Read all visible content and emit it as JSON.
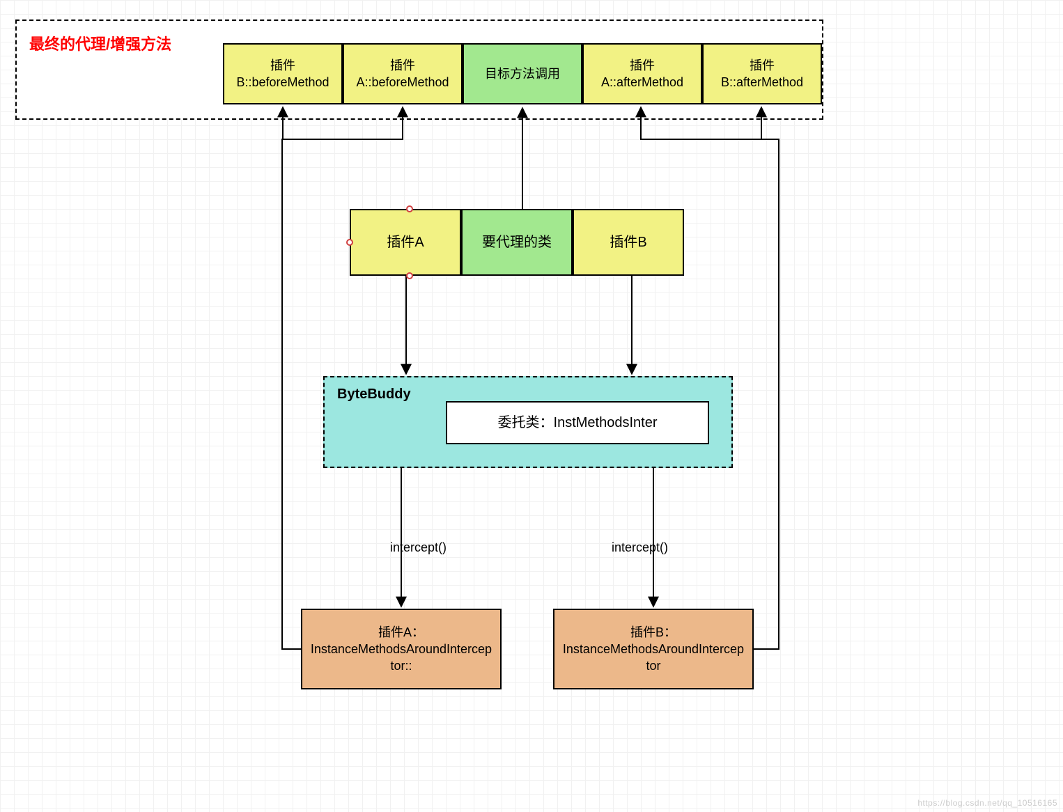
{
  "colors": {
    "yellow": "#f2f284",
    "green": "#a2e88f",
    "cyan": "#9ce7e0",
    "orange": "#ecb88a",
    "white": "#ffffff"
  },
  "diagram": {
    "topBox": {
      "title": "最终的代理/增强方法",
      "items": [
        {
          "name": "b-before",
          "label": "插件B::beforeMethod",
          "color": "yellow"
        },
        {
          "name": "a-before",
          "label": "插件A::beforeMethod",
          "color": "yellow"
        },
        {
          "name": "target",
          "label": "目标方法调用",
          "color": "green"
        },
        {
          "name": "a-after",
          "label": "插件A::afterMethod",
          "color": "yellow"
        },
        {
          "name": "b-after",
          "label": "插件B::afterMethod",
          "color": "yellow"
        }
      ]
    },
    "middle": [
      {
        "name": "plugin-a",
        "label": "插件A",
        "color": "yellow"
      },
      {
        "name": "proxy-class",
        "label": "要代理的类",
        "color": "green"
      },
      {
        "name": "plugin-b",
        "label": "插件B",
        "color": "yellow"
      }
    ],
    "bytebuddy": {
      "title": "ByteBuddy",
      "inner": {
        "name": "delegate-class",
        "label": "委托类：InstMethodsInter"
      }
    },
    "intercept": {
      "labelLeft": "intercept()",
      "labelRight": "intercept()",
      "boxes": [
        {
          "name": "interceptor-a",
          "label": "插件A：InstanceMethodsAroundInterceptor::",
          "color": "orange"
        },
        {
          "name": "interceptor-b",
          "label": "插件B：InstanceMethodsAroundInterceptor",
          "color": "orange"
        }
      ]
    }
  },
  "watermark": "https://blog.csdn.net/qq_10516165"
}
